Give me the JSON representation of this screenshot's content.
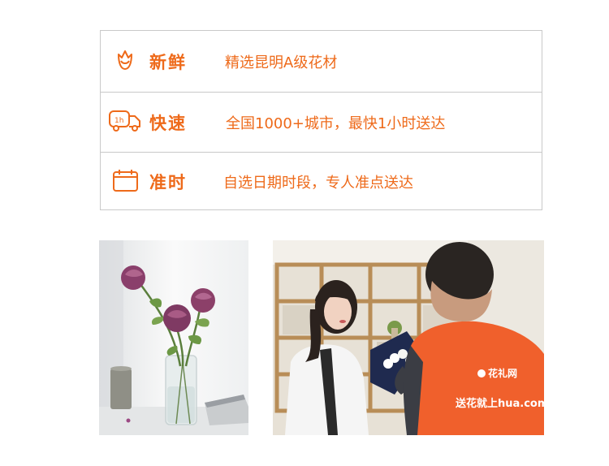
{
  "features": [
    {
      "icon": "rose-icon",
      "title": "新鲜",
      "desc": "精选昆明A级花材"
    },
    {
      "icon": "delivery-truck-1h-icon",
      "title": "快速",
      "desc": "全国1000+城市，最快1小时送达",
      "icon_label": "1h"
    },
    {
      "icon": "calendar-icon",
      "title": "准时",
      "desc": "自选日期时段，专人准点送达"
    }
  ],
  "photos": {
    "left": {
      "subject": "roses-in-vase-photo"
    },
    "right": {
      "subject": "courier-delivering-bouquet-photo",
      "vest_logo": "花礼网",
      "vest_slogan": "送花就上hua.com"
    }
  },
  "colors": {
    "accent": "#ee6a1a",
    "border": "#c9c9c9",
    "vest": "#f0602c"
  }
}
